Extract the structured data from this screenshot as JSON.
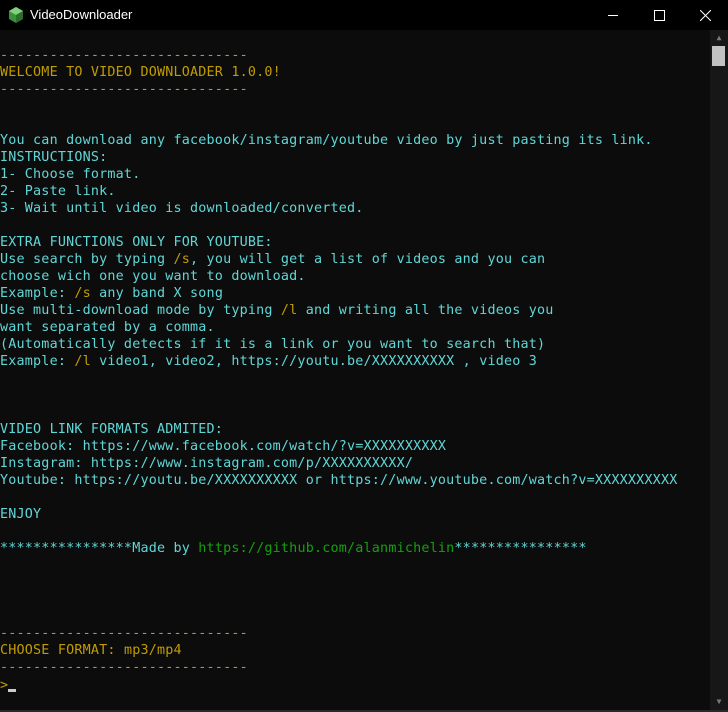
{
  "window": {
    "title": "VideoDownloader",
    "icon": "green-hexagon-app-icon",
    "controls": {
      "minimize": "minimize-icon",
      "maximize": "maximize-icon",
      "close": "close-icon"
    }
  },
  "colors": {
    "background": "#0c0c0c",
    "cyan": "#61d6d6",
    "gold": "#c19c00",
    "white": "#cccccc",
    "green": "#13a10e"
  },
  "console": {
    "rule1": "------------------------------",
    "welcome": "WELCOME TO VIDEO DOWNLOADER 1.0.0!",
    "rule2": "------------------------------",
    "intro": "You can download any facebook/instagram/youtube video by just pasting its link.",
    "instructions": "INSTRUCTIONS:",
    "step1": "1- Choose format.",
    "step2": "2- Paste link.",
    "step3": "3- Wait until video is downloaded/converted.",
    "extra_title": "EXTRA FUNCTIONS ONLY FOR YOUTUBE:",
    "search1a": "Use search by typing ",
    "search1b": "/s",
    "search1c": ", you will get a list of videos and you can",
    "search2": "choose wich one you want to download.",
    "example1a": "Example: ",
    "example1b": "/s",
    "example1c": " any band X song",
    "multi1a": "Use multi-download mode by typing ",
    "multi1b": "/l",
    "multi1c": " and writing all the videos you",
    "multi2": "want separated by a comma.",
    "auto": "(Automatically detects if it is a link or you want to search that)",
    "example2a": "Example: ",
    "example2b": "/l",
    "example2c": " video1, video2, https://youtu.be/XXXXXXXXXX , video 3",
    "formats_title": "VIDEO LINK FORMATS ADMITED:",
    "facebook": "Facebook: https://www.facebook.com/watch/?v=XXXXXXXXXX",
    "instagram": "Instagram: https://www.instagram.com/p/XXXXXXXXXX/",
    "youtube": "Youtube: https://youtu.be/XXXXXXXXXX or https://www.youtube.com/watch?v=XXXXXXXXXX",
    "enjoy": "ENJOY",
    "madeby_a": "****************Made by ",
    "madeby_b": "https://github.com/alanmichelin",
    "madeby_c": "****************",
    "rule3": "------------------------------",
    "choose_label": "CHOOSE FORMAT: ",
    "choose_value": "mp3/mp4",
    "rule4": "------------------------------",
    "prompt": ">"
  }
}
